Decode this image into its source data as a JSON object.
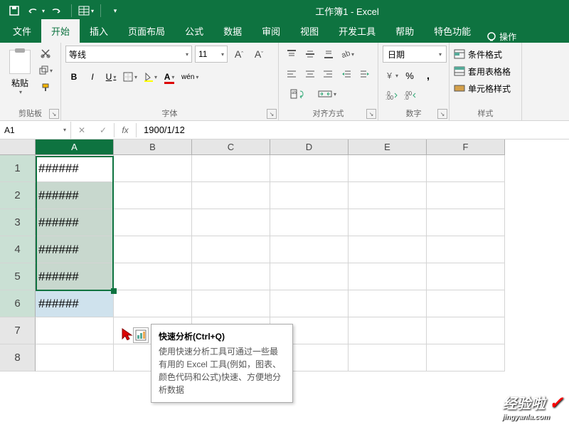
{
  "title": "工作簿1 - Excel",
  "tabs": {
    "file": "文件",
    "home": "开始",
    "insert": "插入",
    "layout": "页面布局",
    "formula": "公式",
    "data": "数据",
    "review": "审阅",
    "view": "视图",
    "dev": "开发工具",
    "help": "帮助",
    "special": "特色功能",
    "tellme": "操作"
  },
  "clipboard": {
    "paste": "粘贴",
    "label": "剪贴板"
  },
  "font": {
    "name": "等线",
    "size": "11",
    "bold": "B",
    "italic": "I",
    "underline": "U",
    "wen": "wén",
    "label": "字体"
  },
  "align": {
    "label": "对齐方式"
  },
  "number": {
    "format": "日期",
    "label": "数字"
  },
  "styles": {
    "cond": "条件格式",
    "table": "套用表格格",
    "cell": "单元格样式",
    "label": "样式"
  },
  "namebox": "A1",
  "formula": "1900/1/12",
  "columns": [
    "A",
    "B",
    "C",
    "D",
    "E",
    "F"
  ],
  "rows": [
    "1",
    "2",
    "3",
    "4",
    "5",
    "6",
    "7",
    "8"
  ],
  "chart_data": {
    "type": "table",
    "title": "",
    "xlabel": "",
    "ylabel": "",
    "columns": [
      "A",
      "B",
      "C",
      "D",
      "E",
      "F"
    ],
    "data": [
      [
        "######",
        "",
        "",
        "",
        "",
        ""
      ],
      [
        "######",
        "",
        "",
        "",
        "",
        ""
      ],
      [
        "######",
        "",
        "",
        "",
        "",
        ""
      ],
      [
        "######",
        "",
        "",
        "",
        "",
        ""
      ],
      [
        "######",
        "",
        "",
        "",
        "",
        ""
      ],
      [
        "######",
        "",
        "",
        "",
        "",
        ""
      ],
      [
        "",
        "",
        "",
        "",
        "",
        ""
      ],
      [
        "",
        "",
        "",
        "",
        "",
        ""
      ]
    ]
  },
  "tooltip": {
    "title": "快速分析(Ctrl+Q)",
    "body": "使用快速分析工具可通过一些最有用的 Excel 工具(例如，图表、颜色代码和公式)快速、方便地分析数据"
  },
  "watermark": {
    "main": "经验啦",
    "sub": "jingyanla.com"
  }
}
